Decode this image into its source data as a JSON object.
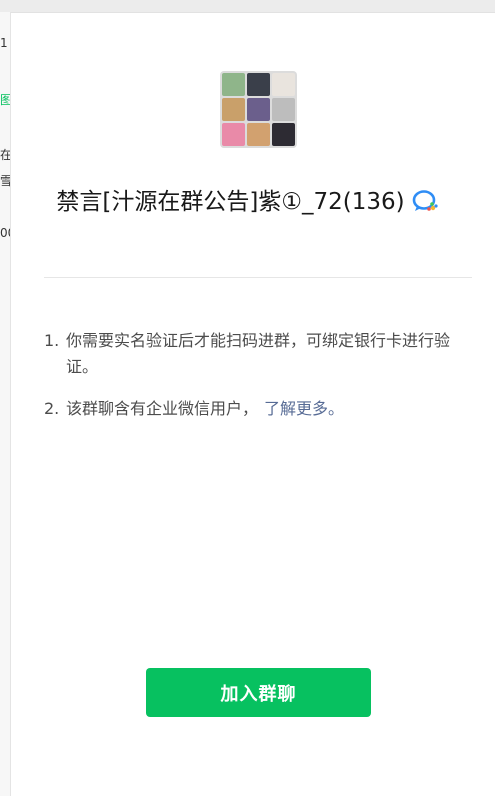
{
  "background_pane": {
    "snippets": [
      "1",
      "图",
      "在",
      "雪",
      "00"
    ]
  },
  "group": {
    "title": "禁言[汁源在群公告]紫①_72(136)",
    "badge_icon": "wecom-icon",
    "avatar_colors": [
      "#8fb58a",
      "#3a3f4a",
      "#e9e4de",
      "#c9a06a",
      "#6b5f8c",
      "#bdbdbd",
      "#e98aa8",
      "#d2a16f",
      "#2d2b33"
    ]
  },
  "notices": [
    {
      "num": "1.",
      "text": "你需要实名验证后才能扫码进群，可绑定银行卡进行验证。"
    },
    {
      "num": "2.",
      "text": "该群聊含有企业微信用户，",
      "link": "了解更多。"
    }
  ],
  "actions": {
    "join_label": "加入群聊"
  },
  "colors": {
    "accent": "#07c160",
    "link": "#576b95"
  }
}
